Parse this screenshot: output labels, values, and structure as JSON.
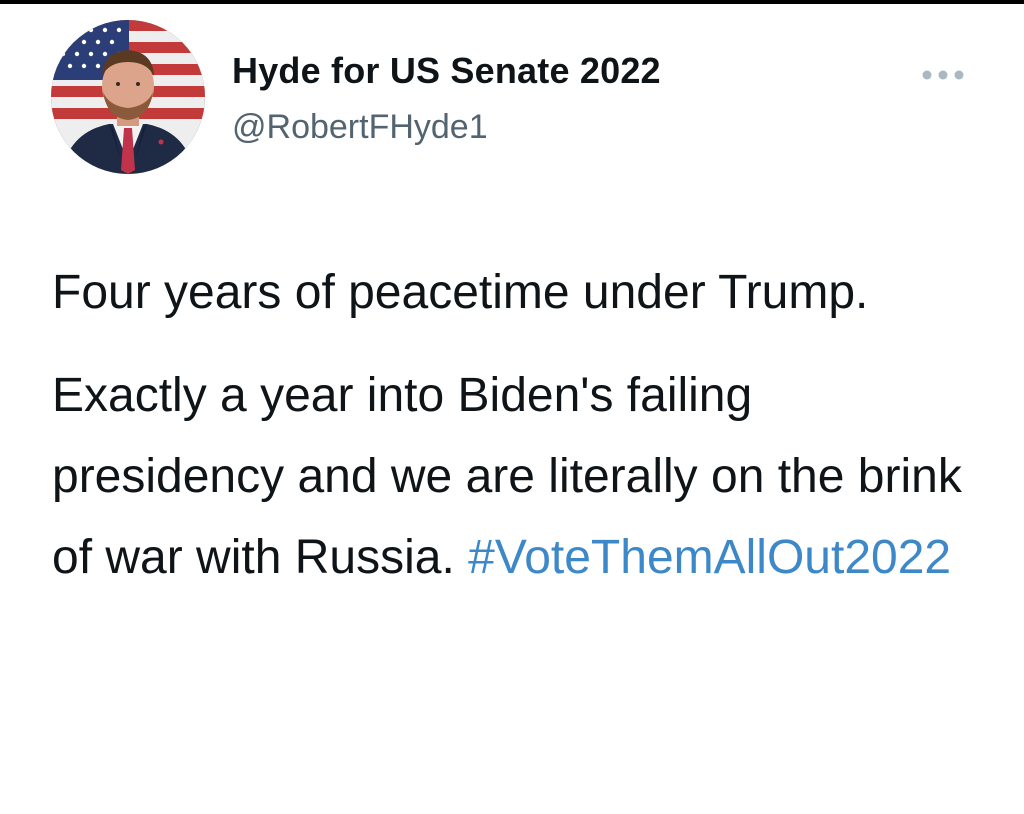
{
  "tweet": {
    "author": {
      "display_name": "Hyde for US Senate 2022",
      "handle": "@RobertFHyde1",
      "avatar_icon": "profile-photo-with-flag"
    },
    "more_icon": "more-horizontal-icon",
    "body": {
      "paragraph_1": "Four years of peacetime under Trump.",
      "paragraph_2_text": "Exactly a year into Biden's failing presidency and we are literally on the brink of war with Russia. ",
      "hashtag": "#VoteThemAllOut2022"
    },
    "colors": {
      "text": "#0f1419",
      "secondary_text": "#536471",
      "hashtag": "#3d88c8",
      "more_dots": "#aab8c2"
    }
  }
}
